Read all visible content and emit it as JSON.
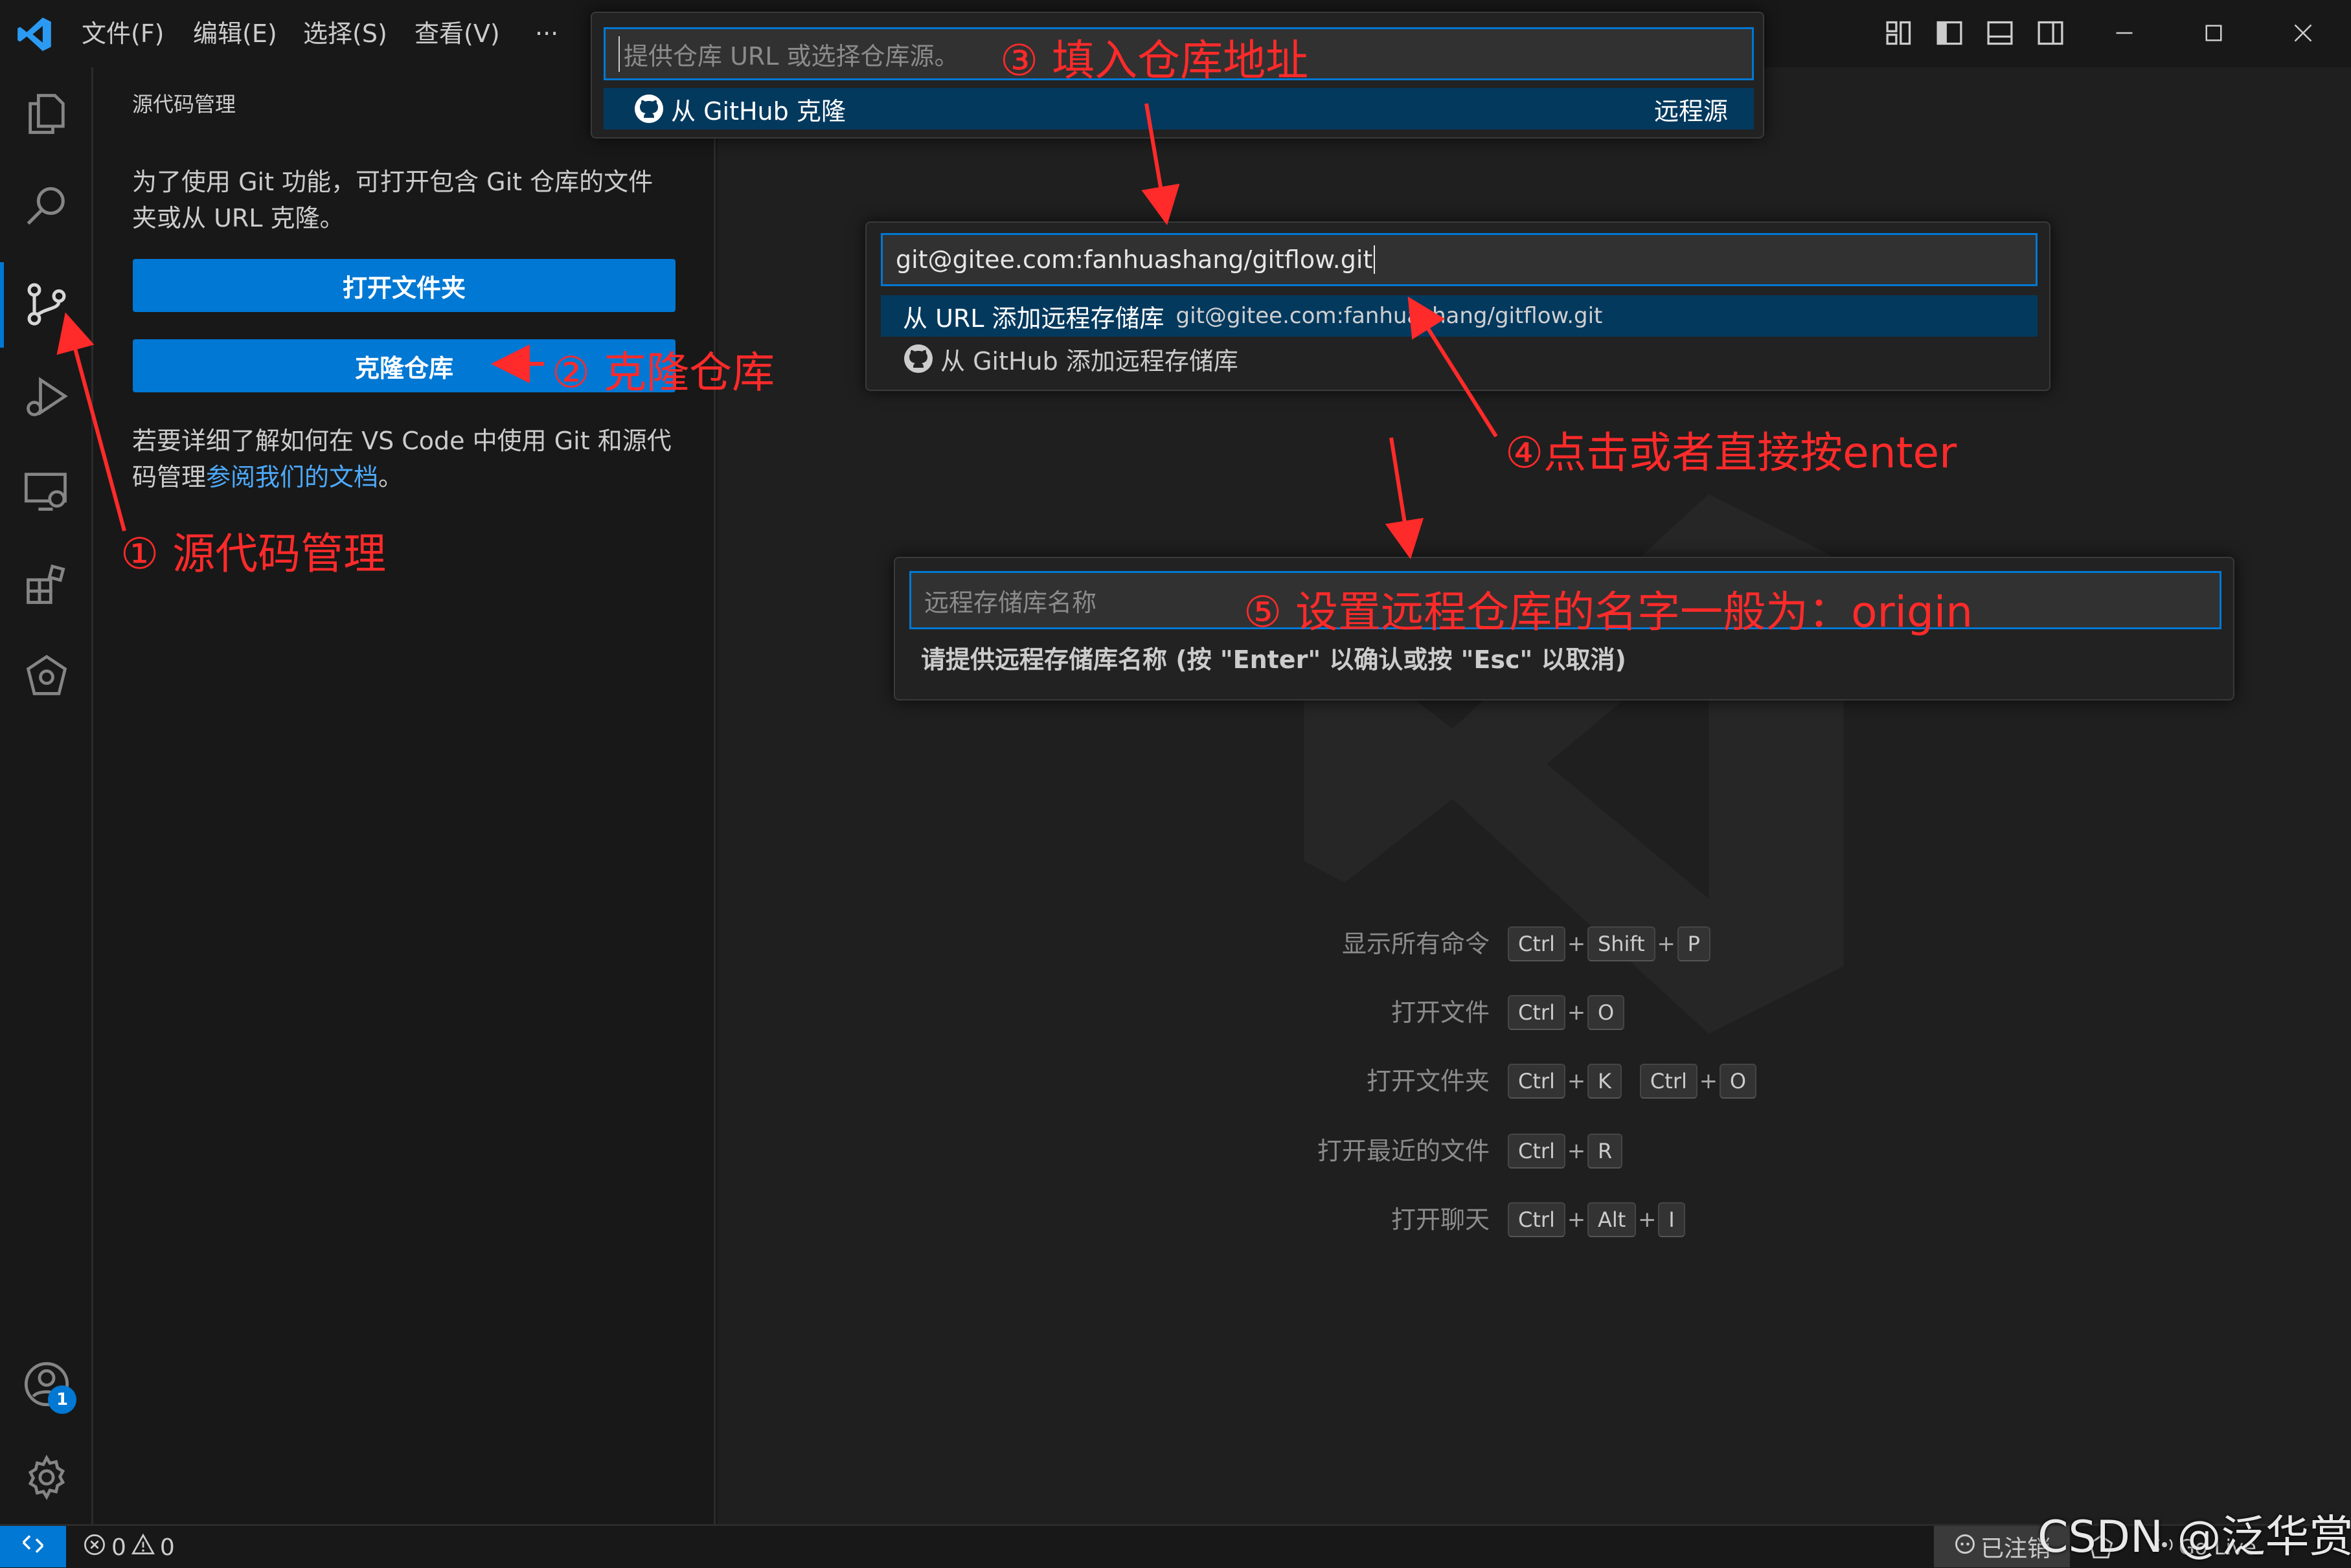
{
  "menu": {
    "file": "文件(F)",
    "edit": "编辑(E)",
    "select": "选择(S)",
    "view": "查看(V)",
    "more": "···"
  },
  "sidebar": {
    "title": "源代码管理",
    "intro_line1": "为了使用 Git 功能，可打开包含 Git 仓库的文件",
    "intro_line2": "夹或从 URL 克隆。",
    "open_folder": "打开文件夹",
    "clone_repo": "克隆仓库",
    "docs_line1": "若要详细了解如何在 VS Code 中使用 Git 和源代",
    "docs_line2_prefix": "码管理",
    "docs_link": "参阅我们的文档",
    "docs_line2_suffix": "。"
  },
  "clone_picker": {
    "placeholder": "提供仓库 URL 或选择仓库源。",
    "item_label": "从 GitHub 克隆",
    "item_detail": "远程源"
  },
  "remote_url_picker": {
    "value": "git@gitee.com:fanhuashang/gitflow.git",
    "item1_label": "从 URL 添加远程存储库",
    "item1_detail": "git@gitee.com:fanhuashang/gitflow.git",
    "item2_label": "从 GitHub 添加远程存储库"
  },
  "remote_name_input": {
    "placeholder": "远程存储库名称",
    "hint": "请提供远程存储库名称 (按 \"Enter\" 以确认或按 \"Esc\" 以取消)"
  },
  "shortcuts": [
    {
      "label": "显示所有命令",
      "keys": [
        "Ctrl",
        "+",
        "Shift",
        "+",
        "P"
      ]
    },
    {
      "label": "打开文件",
      "keys": [
        "Ctrl",
        "+",
        "O"
      ]
    },
    {
      "label": "打开文件夹",
      "keys": [
        "Ctrl",
        "+",
        "K",
        " ",
        "Ctrl",
        "+",
        "O"
      ]
    },
    {
      "label": "打开最近的文件",
      "keys": [
        "Ctrl",
        "+",
        "R"
      ]
    },
    {
      "label": "打开聊天",
      "keys": [
        "Ctrl",
        "+",
        "Alt",
        "+",
        "I"
      ]
    }
  ],
  "statusbar": {
    "errors": "0",
    "warnings": "0",
    "account": "已注销",
    "golive": "Go Live"
  },
  "badges": {
    "accounts": "1"
  },
  "annotations": {
    "a1": "①  源代码管理",
    "a2": "②  克隆仓库",
    "a3": "③  填入仓库地址",
    "a4": "④点击或者直接按enter",
    "a5": "⑤  设置远程仓库的名字一般为：origin",
    "watermark": "CSDN @泛华赏"
  },
  "colors": {
    "accent": "#0078d4",
    "annotation": "#ff2a2a",
    "selection": "#04395e",
    "link": "#4daafc"
  }
}
